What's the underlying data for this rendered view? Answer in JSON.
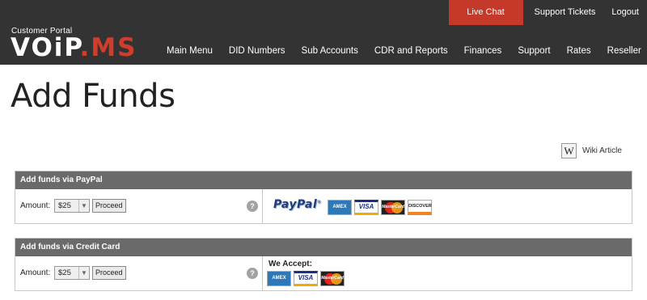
{
  "header": {
    "portal_label": "Customer Portal",
    "logo_text_a": "VOiP",
    "logo_text_b": ".MS",
    "top_links": {
      "live_chat": "Live Chat",
      "support_tickets": "Support Tickets",
      "logout": "Logout"
    },
    "nav": {
      "main_menu": "Main Menu",
      "did_numbers": "DID Numbers",
      "sub_accounts": "Sub Accounts",
      "cdr_reports": "CDR and Reports",
      "finances": "Finances",
      "support": "Support",
      "rates": "Rates",
      "reseller": "Reseller"
    },
    "colors": {
      "bar": "#333333",
      "live_chat": "#c4392a"
    }
  },
  "page": {
    "title": "Add Funds",
    "wiki_icon": "W",
    "wiki_label": "Wiki Article"
  },
  "paypal_panel": {
    "title": "Add funds via PayPal",
    "amount_label": "Amount:",
    "amount_value": "$25",
    "proceed_label": "Proceed",
    "help_icon": "?",
    "brand": "PayPal",
    "cards": {
      "amex": "AMEX",
      "visa": "VISA",
      "mastercard": "MasterCard",
      "discover": "DISCOVER"
    }
  },
  "card_panel": {
    "title": "Add funds via Credit Card",
    "amount_label": "Amount:",
    "amount_value": "$25",
    "proceed_label": "Proceed",
    "help_icon": "?",
    "we_accept": "We Accept:",
    "cards": {
      "amex": "AMEX",
      "visa": "VISA",
      "mastercard": "MasterCard"
    }
  }
}
